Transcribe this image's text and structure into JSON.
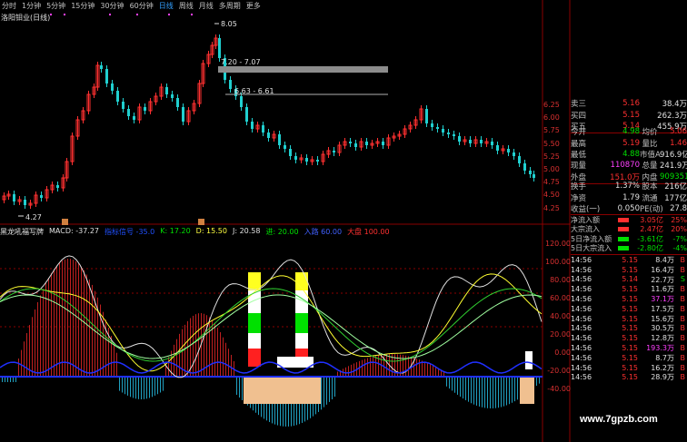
{
  "toolbar": {
    "items": [
      "分时",
      "1分钟",
      "5分钟",
      "15分钟",
      "30分钟",
      "60分钟",
      "日线",
      "周线",
      "月线",
      "多周期",
      "更多"
    ],
    "active_index": 6
  },
  "stock": {
    "title": "洛阳钼业(日线)"
  },
  "main_chart": {
    "annotations": {
      "high": "8.05",
      "low": "4.27",
      "band1": "7.20 - 7.07",
      "band2": "6.63 - 6.61"
    },
    "price_ticks": [
      "6.25",
      "6.00",
      "5.75",
      "5.50",
      "5.25",
      "5.00",
      "4.75",
      "4.50",
      "4.25"
    ]
  },
  "indicator": {
    "name": "黑龙吼福写牌",
    "macd_label": "MACD: -37.27",
    "second_label": "指标信号 -35.0",
    "k_label": "K: 17.20",
    "d_label": "D: 15.50",
    "j_label": "J: 20.58",
    "entry_label": "进: 20.00",
    "in_label": "入路 60.00",
    "big_label": "大盘 100.00",
    "ticks": [
      "120.00",
      "100.00",
      "80.00",
      "60.00",
      "40.00",
      "20.00",
      "0.00",
      "-20.00",
      "-40.00"
    ]
  },
  "quote": {
    "asks": [
      {
        "label": "卖三",
        "price": "5.16",
        "vol": "38.4万"
      },
      {
        "label": "买四",
        "price": "5.15",
        "vol": "262.3万"
      },
      {
        "label": "买五",
        "price": "5.14",
        "vol": "455.9万"
      }
    ],
    "stats": [
      {
        "l1": "今开",
        "v1": "4.98",
        "l2": "均价",
        "v2": "5.06"
      },
      {
        "l1": "最高",
        "v1": "5.19",
        "l2": "量比",
        "v2": "1.46"
      },
      {
        "l1": "最低",
        "v1": "4.88",
        "l2": "市值A",
        "v2": "916.9亿"
      },
      {
        "l1": "现量",
        "v1": "110870",
        "l2": "总量",
        "v2": "241.9万"
      },
      {
        "l1": "外盘",
        "v1": "151.0万",
        "l2": "内盘",
        "v2": "909351"
      }
    ],
    "stats2": [
      {
        "l1": "换手",
        "v1": "1.37%",
        "l2": "股本",
        "v2": "216亿"
      },
      {
        "l1": "净资",
        "v1": "1.79",
        "l2": "流通",
        "v2": "177亿"
      },
      {
        "l1": "收益(一)",
        "v1": "0.050",
        "l2": "PE(动)",
        "v2": "27.8"
      }
    ]
  },
  "money_flow": [
    {
      "label": "净流入额",
      "value": "3.05亿",
      "pct": "25%",
      "color": "#ff3030"
    },
    {
      "label": "大宗流入",
      "value": "2.47亿",
      "pct": "20%",
      "color": "#ff3030"
    },
    {
      "label": "5日净流入额",
      "value": "-3.61亿",
      "pct": "-7%",
      "color": "#00e000"
    },
    {
      "label": "5日大宗流入",
      "value": "-2.80亿",
      "pct": "-4%",
      "color": "#00e000"
    }
  ],
  "ticks": [
    {
      "time": "14:56",
      "price": "5.15",
      "vol": "8.4万",
      "dir": "B"
    },
    {
      "time": "14:56",
      "price": "5.15",
      "vol": "16.4万",
      "dir": "B"
    },
    {
      "time": "14:56",
      "price": "5.14",
      "vol": "22.7万",
      "dir": "S"
    },
    {
      "time": "14:56",
      "price": "5.15",
      "vol": "11.6万",
      "dir": "B"
    },
    {
      "time": "14:56",
      "price": "5.15",
      "vol": "37.1万",
      "dir": "B"
    },
    {
      "time": "14:56",
      "price": "5.15",
      "vol": "17.5万",
      "dir": "B"
    },
    {
      "time": "14:56",
      "price": "5.15",
      "vol": "15.6万",
      "dir": "B"
    },
    {
      "time": "14:56",
      "price": "5.15",
      "vol": "30.5万",
      "dir": "B"
    },
    {
      "time": "14:56",
      "price": "5.15",
      "vol": "12.8万",
      "dir": "B"
    },
    {
      "time": "14:56",
      "price": "5.15",
      "vol": "193.3万",
      "dir": "B"
    },
    {
      "time": "14:56",
      "price": "5.15",
      "vol": "8.7万",
      "dir": "B"
    },
    {
      "time": "14:56",
      "price": "5.15",
      "vol": "16.2万",
      "dir": "B"
    },
    {
      "time": "14:56",
      "price": "5.15",
      "vol": "28.9万",
      "dir": "B"
    }
  ],
  "watermark": "www.7gpzb.com"
}
